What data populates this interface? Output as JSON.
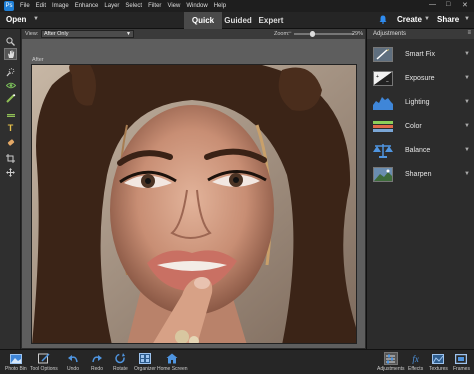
{
  "menubar": {
    "logo": "Ps",
    "items": [
      "File",
      "Edit",
      "Image",
      "Enhance",
      "Layer",
      "Select",
      "Filter",
      "View",
      "Window",
      "Help"
    ],
    "window_controls": {
      "minimize": "—",
      "maximize": "□",
      "close": "✕"
    }
  },
  "topbar": {
    "open_label": "Open",
    "modes": [
      {
        "label": "Quick",
        "active": true
      },
      {
        "label": "Guided",
        "active": false
      },
      {
        "label": "Expert",
        "active": false
      }
    ],
    "create_label": "Create",
    "share_label": "Share"
  },
  "toolbar": {
    "tools": [
      "zoom-icon",
      "hand-icon",
      "quick-selection-icon",
      "eye-icon",
      "whiten-teeth-icon",
      "straighten-icon",
      "type-icon",
      "spot-healing-icon",
      "crop-icon",
      "move-icon"
    ]
  },
  "options": {
    "view_label": "View:",
    "view_value": "After Only",
    "zoom_label": "Zoom:",
    "zoom_value": "29%",
    "zoom_fraction": 0.29
  },
  "canvas": {
    "after_label": "After"
  },
  "panel": {
    "title": "Adjustments",
    "items": [
      {
        "label": "Smart Fix",
        "icon": "smart-fix-icon"
      },
      {
        "label": "Exposure",
        "icon": "exposure-icon"
      },
      {
        "label": "Lighting",
        "icon": "lighting-icon"
      },
      {
        "label": "Color",
        "icon": "color-icon"
      },
      {
        "label": "Balance",
        "icon": "balance-icon"
      },
      {
        "label": "Sharpen",
        "icon": "sharpen-icon"
      }
    ]
  },
  "bottombar": {
    "left": [
      {
        "label": "Photo Bin",
        "icon": "photo-bin-icon"
      },
      {
        "label": "Tool Options",
        "icon": "tool-options-icon"
      },
      {
        "label": "Undo",
        "icon": "undo-icon"
      },
      {
        "label": "Redo",
        "icon": "redo-icon"
      },
      {
        "label": "Rotate",
        "icon": "rotate-icon"
      },
      {
        "label": "Organizer",
        "icon": "organizer-icon"
      },
      {
        "label": "Home Screen",
        "icon": "home-icon"
      }
    ],
    "right": [
      {
        "label": "Adjustments",
        "icon": "adjustments-icon",
        "active": true
      },
      {
        "label": "Effects",
        "icon": "effects-icon"
      },
      {
        "label": "Textures",
        "icon": "textures-icon"
      },
      {
        "label": "Frames",
        "icon": "frames-icon"
      }
    ]
  },
  "colors": {
    "accent": "#1f7fd6",
    "active_tab": "#4a4a4a",
    "background": "#2b2b2b"
  }
}
